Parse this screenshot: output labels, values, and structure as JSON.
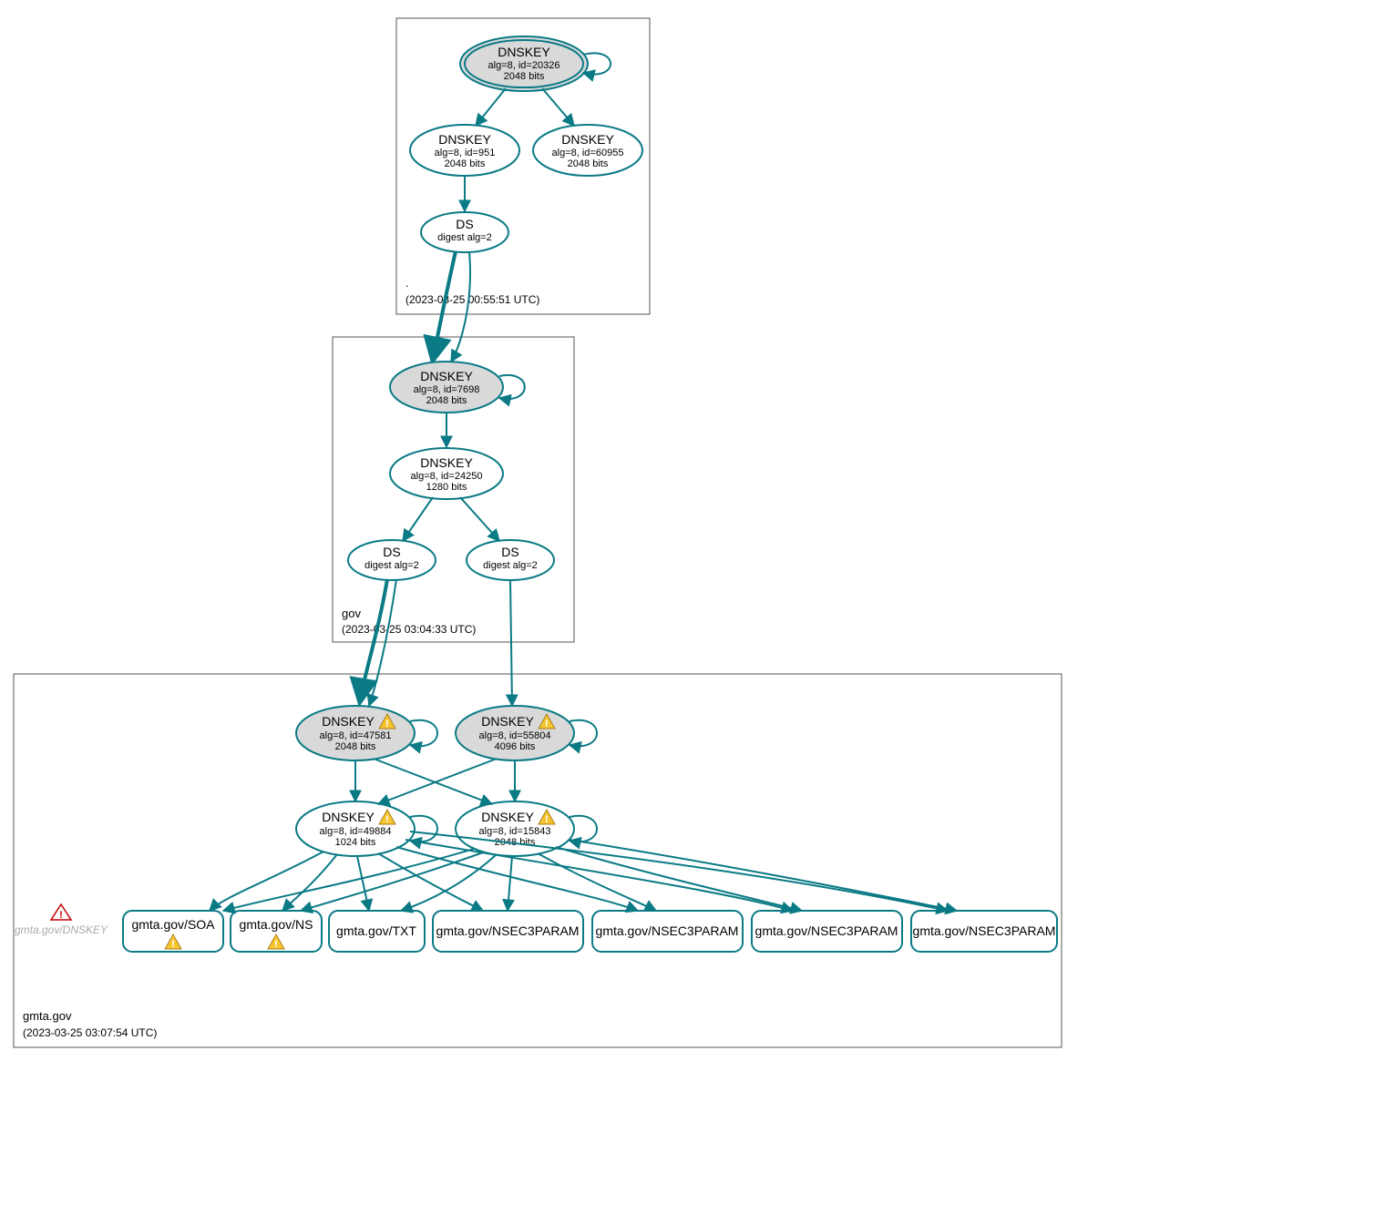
{
  "clusters": {
    "root": {
      "label": ".",
      "timestamp": "(2023-03-25 00:55:51 UTC)"
    },
    "gov": {
      "label": "gov",
      "timestamp": "(2023-03-25 03:04:33 UTC)"
    },
    "gmta": {
      "label": "gmta.gov",
      "timestamp": "(2023-03-25 03:07:54 UTC)"
    }
  },
  "nodes": {
    "root_ksk": {
      "title": "DNSKEY",
      "line1": "alg=8, id=20326",
      "line2": "2048 bits"
    },
    "root_zsk1": {
      "title": "DNSKEY",
      "line1": "alg=8, id=951",
      "line2": "2048 bits"
    },
    "root_zsk2": {
      "title": "DNSKEY",
      "line1": "alg=8, id=60955",
      "line2": "2048 bits"
    },
    "root_ds": {
      "title": "DS",
      "line1": "digest alg=2",
      "line2": ""
    },
    "gov_ksk": {
      "title": "DNSKEY",
      "line1": "alg=8, id=7698",
      "line2": "2048 bits"
    },
    "gov_zsk": {
      "title": "DNSKEY",
      "line1": "alg=8, id=24250",
      "line2": "1280 bits"
    },
    "gov_ds1": {
      "title": "DS",
      "line1": "digest alg=2",
      "line2": ""
    },
    "gov_ds2": {
      "title": "DS",
      "line1": "digest alg=2",
      "line2": ""
    },
    "gmta_ksk1": {
      "title": "DNSKEY",
      "line1": "alg=8, id=47581",
      "line2": "2048 bits"
    },
    "gmta_ksk2": {
      "title": "DNSKEY",
      "line1": "alg=8, id=55804",
      "line2": "4096 bits"
    },
    "gmta_zsk1": {
      "title": "DNSKEY",
      "line1": "alg=8, id=49884",
      "line2": "1024 bits"
    },
    "gmta_zsk2": {
      "title": "DNSKEY",
      "line1": "alg=8, id=15843",
      "line2": "2048 bits"
    },
    "leaf_soa": {
      "label": "gmta.gov/SOA"
    },
    "leaf_ns": {
      "label": "gmta.gov/NS"
    },
    "leaf_txt": {
      "label": "gmta.gov/TXT"
    },
    "leaf_n3p1": {
      "label": "gmta.gov/NSEC3PARAM"
    },
    "leaf_n3p2": {
      "label": "gmta.gov/NSEC3PARAM"
    },
    "leaf_n3p3": {
      "label": "gmta.gov/NSEC3PARAM"
    },
    "leaf_n3p4": {
      "label": "gmta.gov/NSEC3PARAM"
    },
    "ghost": {
      "label": "gmta.gov/DNSKEY"
    }
  }
}
